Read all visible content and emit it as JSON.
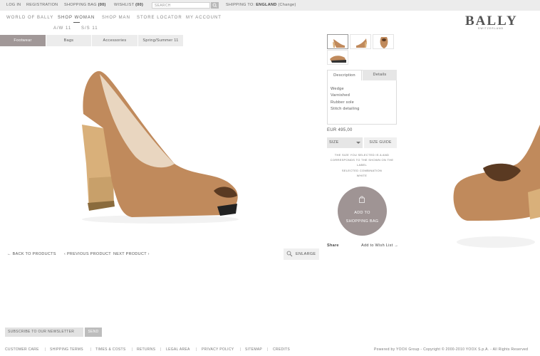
{
  "topbar": {
    "login": "LOG IN",
    "registration": "REGISTRATION",
    "shopping_bag": "SHOPPING BAG",
    "shopping_bag_count": "(00)",
    "wishlist": "WISHLIST",
    "wishlist_count": "(00)",
    "search_placeholder": "SEARCH",
    "shipping_to": "SHIPPING TO:",
    "shipping_country": "ENGLAND",
    "change": "(Change)"
  },
  "nav": {
    "items": [
      "WORLD OF BALLY",
      "SHOP WOMAN",
      "SHOP MAN",
      "STORE LOCATOR",
      "MY ACCOUNT"
    ],
    "sub": [
      "A/W 11",
      "S/S 11"
    ]
  },
  "logo": {
    "name": "BALLY",
    "sub": "SWITZERLAND"
  },
  "categories": [
    "Footwear",
    "Bags",
    "Accessories",
    "Spring/Summer 11"
  ],
  "product": {
    "tabs": [
      "Description",
      "Details"
    ],
    "features": [
      "Wedge",
      "Varnished",
      "Rubber sole",
      "Stitch detailing"
    ],
    "price": "EUR 495,00",
    "size_label": "SIZE",
    "size_guide": "SIZE GUIDE",
    "note_lines": [
      "THE SIZE YOU SELECTED IS A AND",
      "CORRESPONDS TO THE SHOWN ON THE",
      "LABEL",
      "SELECTED COMBINATION",
      "WHITE"
    ],
    "add_to_bag_line1": "ADD TO",
    "add_to_bag_line2": "SHOPPING BAG",
    "share": "Share",
    "wishlist": "Add to Wish List"
  },
  "product_nav": {
    "back": "BACK TO PRODUCTS",
    "previous": "PREVIOUS PRODUCT",
    "next": "NEXT PRODUCT",
    "enlarge": "ENLARGE"
  },
  "newsletter": {
    "placeholder": "SUBSCRIBE TO OUR NEWSLETTER",
    "send": "SEND"
  },
  "footer": {
    "links": [
      "CUSTOMER CARE",
      "SHIPPING TERMS",
      "TIMES & COSTS",
      "RETURNS",
      "LEGAL AREA",
      "PRIVACY POLICY",
      "SITEMAP",
      "CREDITS"
    ],
    "copyright": "Powered by YOOX Group - Copyright © 2000-2010 YOOX S.p.A. - All Rights Reserved"
  },
  "colors": {
    "accent": "#9f9494",
    "shoe": "#c08a5c",
    "heel": "#d8b27a"
  }
}
